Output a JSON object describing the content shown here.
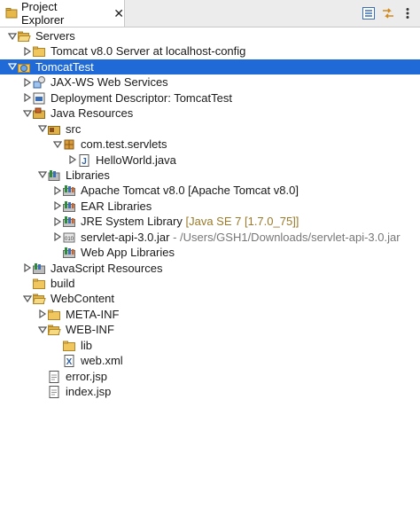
{
  "tab": {
    "title": "Project Explorer",
    "close": "✕"
  },
  "tree": [
    {
      "label": "Servers",
      "depth": 0,
      "tw": "open",
      "icon": "folder-open-icon"
    },
    {
      "label": "Tomcat v8.0 Server at localhost-config",
      "depth": 1,
      "tw": "closed",
      "icon": "folder-icon"
    },
    {
      "label": "TomcatTest",
      "depth": 0,
      "tw": "open",
      "icon": "web-project-icon",
      "selected": true
    },
    {
      "label": "JAX-WS Web Services",
      "depth": 1,
      "tw": "closed",
      "icon": "web-services-icon"
    },
    {
      "label": "Deployment Descriptor: TomcatTest",
      "depth": 1,
      "tw": "closed",
      "icon": "deployment-descriptor-icon"
    },
    {
      "label": "Java Resources",
      "depth": 1,
      "tw": "open",
      "icon": "java-resources-icon"
    },
    {
      "label": "src",
      "depth": 2,
      "tw": "open",
      "icon": "source-folder-icon"
    },
    {
      "label": "com.test.servlets",
      "depth": 3,
      "tw": "open",
      "icon": "package-icon"
    },
    {
      "label": "HelloWorld.java",
      "depth": 4,
      "tw": "closed",
      "icon": "java-file-icon"
    },
    {
      "label": "Libraries",
      "depth": 2,
      "tw": "open",
      "icon": "libraries-icon"
    },
    {
      "label": "Apache Tomcat v8.0 [Apache Tomcat v8.0]",
      "depth": 3,
      "tw": "closed",
      "icon": "library-icon"
    },
    {
      "label": "EAR Libraries",
      "depth": 3,
      "tw": "closed",
      "icon": "library-icon"
    },
    {
      "label": "JRE System Library",
      "deco": "[Java SE 7 [1.7.0_75]]",
      "decoClass": "deco",
      "depth": 3,
      "tw": "closed",
      "icon": "library-icon"
    },
    {
      "label": "servlet-api-3.0.jar",
      "deco": "- /Users/GSH1/Downloads/servlet-api-3.0.jar",
      "decoClass": "deco-gray",
      "depth": 3,
      "tw": "closed",
      "icon": "jar-icon"
    },
    {
      "label": "Web App Libraries",
      "depth": 3,
      "tw": "none",
      "icon": "library-icon"
    },
    {
      "label": "JavaScript Resources",
      "depth": 1,
      "tw": "closed",
      "icon": "javascript-resources-icon"
    },
    {
      "label": "build",
      "depth": 1,
      "tw": "none",
      "icon": "folder-icon"
    },
    {
      "label": "WebContent",
      "depth": 1,
      "tw": "open",
      "icon": "folder-open-icon"
    },
    {
      "label": "META-INF",
      "depth": 2,
      "tw": "closed",
      "icon": "folder-icon"
    },
    {
      "label": "WEB-INF",
      "depth": 2,
      "tw": "open",
      "icon": "folder-open-icon"
    },
    {
      "label": "lib",
      "depth": 3,
      "tw": "none",
      "icon": "folder-icon"
    },
    {
      "label": "web.xml",
      "depth": 3,
      "tw": "none",
      "icon": "xml-file-icon"
    },
    {
      "label": "error.jsp",
      "depth": 2,
      "tw": "none",
      "icon": "jsp-file-icon"
    },
    {
      "label": "index.jsp",
      "depth": 2,
      "tw": "none",
      "icon": "jsp-file-icon"
    }
  ]
}
